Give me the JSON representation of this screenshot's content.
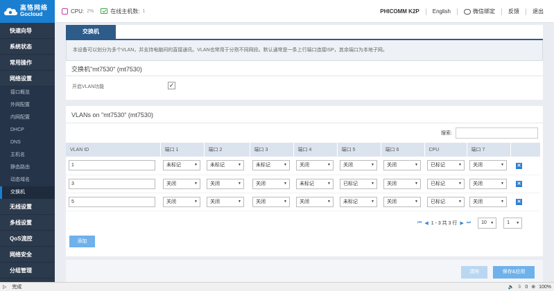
{
  "header": {
    "logo_cn": "高恪网络",
    "logo_en": "Gocloud",
    "cpu_label": "CPU:",
    "cpu_value": "2%",
    "hosts_label": "在线主机数:",
    "hosts_value": "1",
    "device": "PHICOMM K2P",
    "lang": "English",
    "wechat": "微信绑定",
    "feedback": "反馈",
    "logout": "退出"
  },
  "sidebar": {
    "items": [
      {
        "label": "快速向导"
      },
      {
        "label": "系统状态"
      },
      {
        "label": "常用操作"
      },
      {
        "label": "网络设置"
      }
    ],
    "sub_items": [
      {
        "label": "接口概览"
      },
      {
        "label": "外网配置"
      },
      {
        "label": "内网配置"
      },
      {
        "label": "DHCP"
      },
      {
        "label": "DNS"
      },
      {
        "label": "主机名"
      },
      {
        "label": "静态路由"
      },
      {
        "label": "动态域名"
      },
      {
        "label": "交换机"
      }
    ],
    "bottom_items": [
      {
        "label": "无线设置"
      },
      {
        "label": "多线设置"
      },
      {
        "label": "QoS流控"
      },
      {
        "label": "网络安全"
      },
      {
        "label": "分组管理"
      }
    ]
  },
  "switch_tab": "交换机",
  "description": "本设备可以划分为多个VLAN，并支持电脑间的直接通讯。VLAN也常用于分割不同网段。默认通常是一条上行端口连接ISP，其余端口为本地子网。",
  "switch_title": "交换机\"mt7530\" (mt7530)",
  "enable_vlan_label": "开启VLAN功能",
  "enable_vlan_checked": "✓",
  "vlans_title": "VLANs on \"mt7530\" (mt7530)",
  "search_label": "搜索:",
  "table": {
    "headers": [
      "VLAN ID",
      "端口 1",
      "端口 2",
      "端口 3",
      "端口 4",
      "端口 5",
      "端口 6",
      "CPU",
      "端口 7"
    ],
    "rows": [
      {
        "id": "1",
        "cells": [
          "未标记",
          "未标记",
          "未标记",
          "关闭",
          "关闭",
          "关闭",
          "已标记",
          "关闭"
        ]
      },
      {
        "id": "3",
        "cells": [
          "关闭",
          "关闭",
          "关闭",
          "未标记",
          "已标记",
          "关闭",
          "已标记",
          "关闭"
        ]
      },
      {
        "id": "5",
        "cells": [
          "关闭",
          "关闭",
          "关闭",
          "关闭",
          "未标记",
          "关闭",
          "已标记",
          "关闭"
        ]
      }
    ]
  },
  "pagination": {
    "info": "1 - 3 共 3 行",
    "page_size": "10",
    "page": "1"
  },
  "add_button": "添加",
  "clear_button": "清除",
  "save_button": "保存&应用",
  "statusbar": {
    "status": "完成",
    "count": "0",
    "zoom": "100%"
  }
}
